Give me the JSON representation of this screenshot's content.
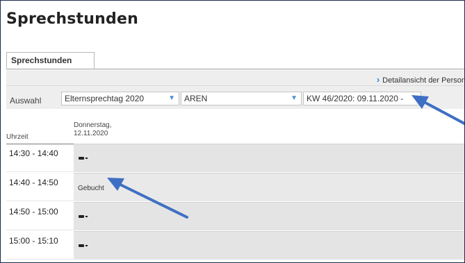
{
  "page": {
    "title": "Sprechstunden",
    "tab_label": "Sprechstunden"
  },
  "toolbar": {
    "detail_link": "Detailansicht der Person",
    "auswahl_label": "Auswahl",
    "select_event": "Elternsprechtag 2020",
    "select_person": "AREN",
    "select_week": "KW 46/2020: 09.11.2020 -"
  },
  "table": {
    "header_time": "Uhrzeit",
    "header_day_line1": "Donnerstag,",
    "header_day_line2": "12.11.2020",
    "rows": [
      {
        "time": "14:30 - 14:40",
        "status": ""
      },
      {
        "time": "14:40 - 14:50",
        "status": "Gebucht"
      },
      {
        "time": "14:50 - 15:00",
        "status": ""
      },
      {
        "time": "15:00 - 15:10",
        "status": ""
      }
    ]
  },
  "colors": {
    "annotation_arrow": "#3f6fc4",
    "link_chevron": "#1e88e5"
  }
}
